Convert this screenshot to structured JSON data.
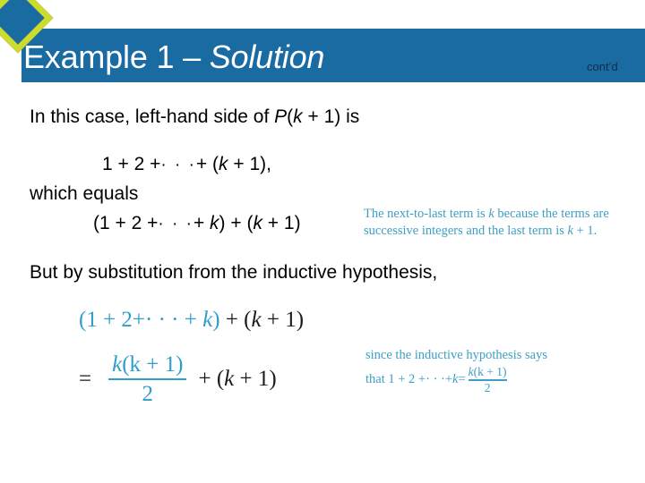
{
  "slide": {
    "title_regular": "Example 1 – ",
    "title_italic": "Solution",
    "contd": "cont’d",
    "banner_color": "#1b6ba3",
    "diamond_outline_color": "#ccdb2c",
    "diamond_fill_color": "#1b6ba3",
    "annotation_color": "#3d9fc4",
    "math_teal_color": "#2e9ecb"
  },
  "body": {
    "intro_pre": "In this case, left-hand side of ",
    "intro_P": "P",
    "intro_open": "(",
    "intro_k": "k",
    "intro_plus1": " + 1) is",
    "eq1_pre": "1 + 2 +",
    "eq1_dots": "· · ·",
    "eq1_mid": "+ (",
    "eq1_k": "k",
    "eq1_post": " + 1),",
    "which_equals": "which equals",
    "eq2_pre": "(1 + 2 +",
    "eq2_dots": "· · ·",
    "eq2_mid": "+ ",
    "eq2_k1": "k",
    "eq2_mid2": ") + (",
    "eq2_k2": "k",
    "eq2_post": " + 1)",
    "but_line": "But by substitution from the inductive hypothesis,"
  },
  "math": {
    "row1_open": "(1 + 2+",
    "row1_dots": "· · ·",
    "row1_plus": " + ",
    "row1_k": "k",
    "row1_close": ")",
    "row1_tail_open": " + (",
    "row1_tail_k": "k",
    "row1_tail_close": " + 1)",
    "eq_sign": "=",
    "frac_num_k": "k",
    "frac_num_rest": "(k + 1)",
    "frac_den": "2",
    "tail_open": "+ (",
    "tail_k": "k",
    "tail_close": " + 1)"
  },
  "annotations": {
    "top_line1_pre": "The next-to-last term is ",
    "top_line1_k": "k",
    "top_line1_post": " because the terms are",
    "top_line2_pre": "successive integers and the last term is ",
    "top_line2_k": "k",
    "top_line2_post": " + 1.",
    "bottom_line1": "since the inductive hypothesis says",
    "bottom_line2_pre": "that 1 + 2 + ",
    "bottom_line2_dots": "· · ·",
    "bottom_line2_mid": " + ",
    "bottom_line2_k": "k",
    "bottom_line2_eq": " = ",
    "bottom_frac_num_k": "k",
    "bottom_frac_num_rest": "(k + 1)",
    "bottom_frac_den": "2"
  }
}
